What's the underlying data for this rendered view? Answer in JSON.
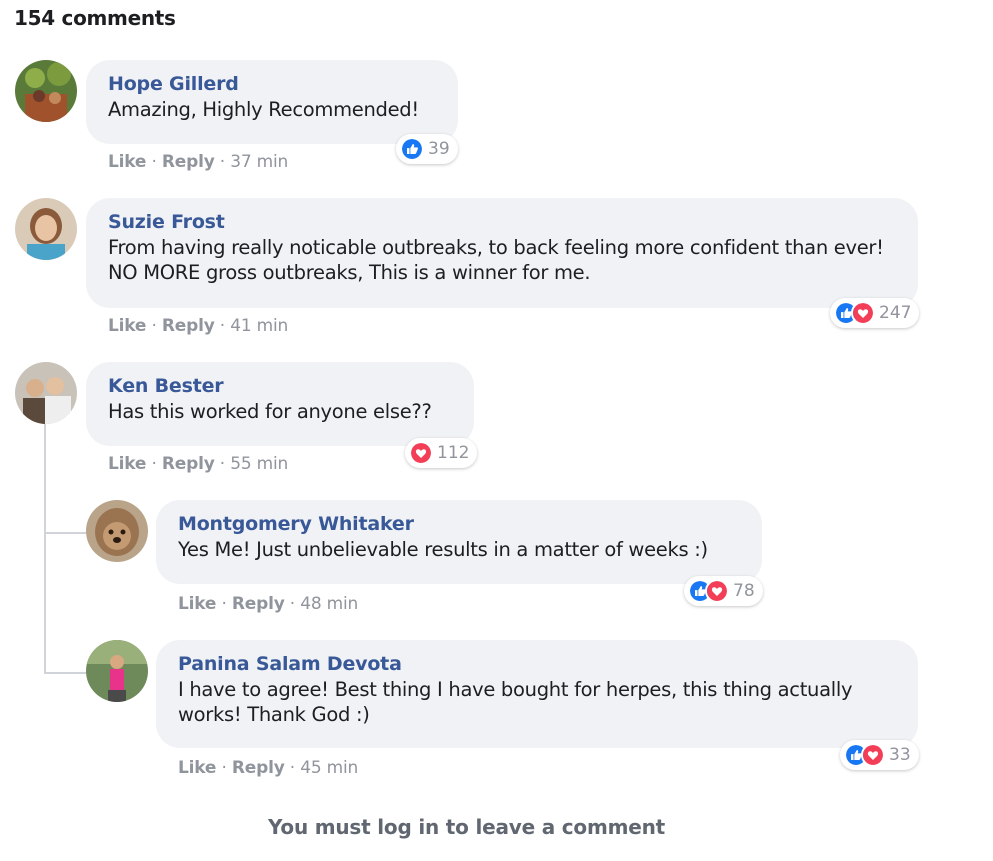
{
  "header": {
    "comment_count": "154 comments"
  },
  "comments": [
    {
      "name": "Hope Gillerd",
      "text": "Amazing, Highly Recommended!",
      "like": "Like",
      "reply": "Reply",
      "time": "37 min",
      "reactions": "39",
      "reaction_icons": [
        "like-icon"
      ]
    },
    {
      "name": "Suzie Frost",
      "text": "From having really noticable outbreaks, to back feeling more confident than ever! NO MORE gross outbreaks, This is a winner for me.",
      "like": "Like",
      "reply": "Reply",
      "time": "41 min",
      "reactions": "247",
      "reaction_icons": [
        "like-icon",
        "love-icon"
      ]
    },
    {
      "name": "Ken Bester",
      "text": "Has this worked for anyone else??",
      "like": "Like",
      "reply": "Reply",
      "time": "55 min",
      "reactions": "112",
      "reaction_icons": [
        "love-icon"
      ]
    },
    {
      "name": "Montgomery Whitaker",
      "text": "Yes Me! Just unbelievable results in a matter of weeks :)",
      "like": "Like",
      "reply": "Reply",
      "time": "48 min",
      "reactions": "78",
      "reaction_icons": [
        "like-icon",
        "love-icon"
      ]
    },
    {
      "name": "Panina Salam Devota",
      "text": "I have to agree! Best thing I have bought for herpes, this thing actually works! Thank God :)",
      "like": "Like",
      "reply": "Reply",
      "time": "45 min",
      "reactions": "33",
      "reaction_icons": [
        "like-icon",
        "love-icon"
      ]
    }
  ],
  "footer": {
    "login_message": "You must log in to leave a comment"
  },
  "colors": {
    "name": "#385898",
    "bubble": "#f0f2f5",
    "meta": "#90949c",
    "like": "#1877f2",
    "love": "#f33e58",
    "login": "#606770"
  }
}
